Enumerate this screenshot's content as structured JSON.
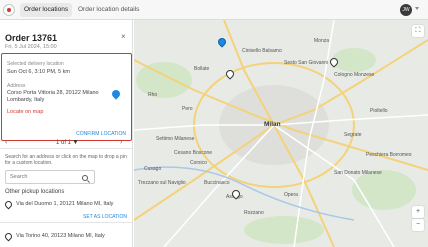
{
  "header": {
    "tabs": [
      {
        "label": "Order locations"
      },
      {
        "label": "Order location details"
      }
    ],
    "avatar_initials": "JW"
  },
  "panel": {
    "order_title": "Order 13761",
    "order_subtitle": "Fri, 5 Jul 2024, 15:00",
    "close_symbol": "×",
    "card": {
      "label": "Selected delivery location",
      "date": "Sun Oct 6, 3:10 PM, 5 km",
      "sub_label": "Address",
      "address_line1": "Corso Porta Vittoria 28, 20122 Milano",
      "address_line2": "Lombardy, Italy",
      "link": "Locate on map",
      "confirm": "CONFIRM LOCATION"
    },
    "pager": {
      "prev": "‹",
      "count": "1 of 1",
      "next": "›"
    },
    "help_text_1": "Search for an address or click on the map to drop a pin",
    "help_text_2": "for a custom location.",
    "search": {
      "placeholder": "Search"
    },
    "section_heading": "Other pickup locations",
    "locations": [
      {
        "text": "Via del Duomo 1, 20121 Milano MI, Italy",
        "action": "SET AS LOCATION"
      },
      {
        "text": "Via Torino 40, 20123 Milano MI, Italy",
        "action": ""
      }
    ]
  },
  "map": {
    "center_label": "Milan",
    "places": [
      "Monza",
      "Sesto San Giovanni",
      "Cologno Monzese",
      "Cinisello Balsamo",
      "Rho",
      "Pero",
      "Bollate",
      "Segrate",
      "Settimo Milanese",
      "Cusago",
      "Buccinasco",
      "Corsico",
      "Rozzano",
      "Opera",
      "San Donato Milanese",
      "Assago",
      "Cesano Boscone",
      "Trezzano sul Naviglio",
      "Pioltello",
      "Peschiera Borromeo"
    ],
    "controls": {
      "top": "⛶",
      "zoom_in": "+",
      "zoom_out": "−"
    },
    "colors": {
      "accent": "#d0392f",
      "link": "#1e88e5",
      "map_bg": "#e8eae6"
    }
  }
}
